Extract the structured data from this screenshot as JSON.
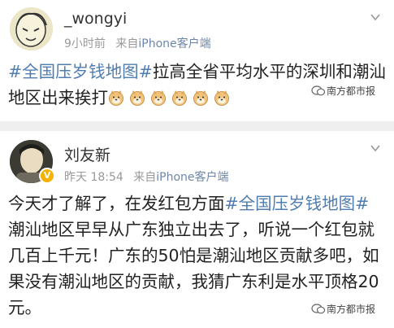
{
  "post1": {
    "username": "_wongyi",
    "time": "9小时前",
    "source_prefix": "来自",
    "source": "iPhone客户端",
    "hashtag": "#全国压岁钱地图#",
    "body": "拉高全省平均水平的深圳和潮汕地区出来挨打",
    "emoji_names": [
      "doge",
      "doge",
      "doge",
      "doge",
      "doge",
      "doge"
    ],
    "watermark": "南方都市报"
  },
  "post2": {
    "username": "刘友新",
    "time": "昨天 18:54",
    "source_prefix": "来自",
    "source": "iPhone客户端",
    "lead": "今天才了解了，在发红包方面",
    "hashtag": "#全国压岁钱地图#",
    "body": " 潮汕地区早早从广东独立出去了，听说一个红包就几百上千元！广东的50怕是潮汕地区贡献多吧，如果没有潮汕地区的贡献，我猜广东利是水平顶格20元。",
    "watermark": "南方都市报",
    "badge": "V"
  },
  "colors": {
    "link": "#507daf",
    "meta": "#999999",
    "source": "#6d86a8",
    "badge": "#f6b200"
  }
}
